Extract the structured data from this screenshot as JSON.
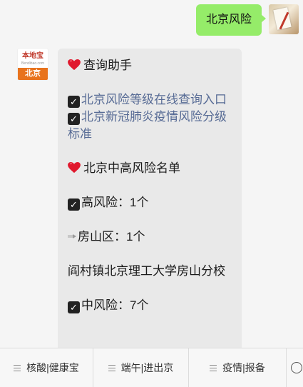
{
  "user_message": {
    "text": "北京风险"
  },
  "bot_avatar": {
    "brand": "本地宝",
    "domain": "Bendibao.com",
    "city": "北京"
  },
  "bot_message": {
    "section1_title": "查询助手",
    "link1": "北京风险等级在线查询入口",
    "link2": "北京新冠肺炎疫情风险分级标准",
    "section2_title": "北京中高风险名单",
    "high_risk": "高风险：1个",
    "district": "房山区：1个",
    "location": "阎村镇北京理工大学房山分校",
    "medium_risk": "中风险：7个"
  },
  "menu": [
    "核酸|健康宝",
    "端午|进出京",
    "疫情|报备"
  ],
  "colors": {
    "user_bubble": "#95ec69",
    "link": "#576b95",
    "bot_bubble": "#e9e9e9",
    "brand_orange": "#e8731d"
  },
  "icons": [
    "heart-icon",
    "checkbox-icon",
    "pin-icon",
    "menu-lines-icon",
    "keyboard-circle-icon"
  ]
}
